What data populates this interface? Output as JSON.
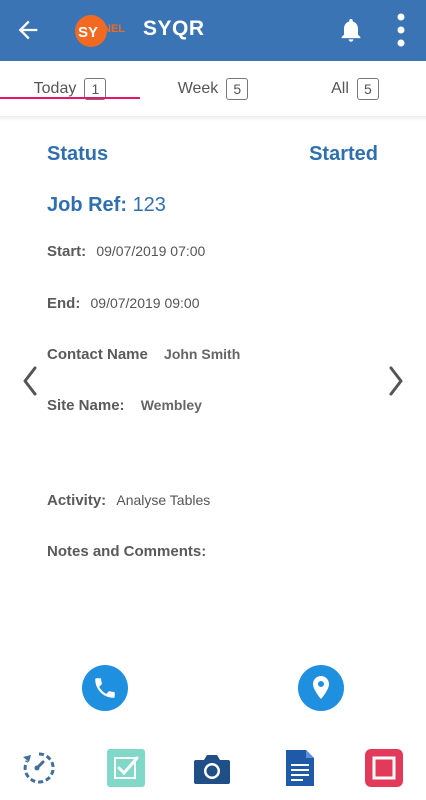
{
  "appbar": {
    "logo_alt": "SYNEL",
    "title": "SYQR"
  },
  "tabs": [
    {
      "label": "Today",
      "count": "1"
    },
    {
      "label": "Week",
      "count": "5"
    },
    {
      "label": "All",
      "count": "5"
    }
  ],
  "job": {
    "status_label": "Status",
    "status_value": "Started",
    "jobref_label": "Job Ref:",
    "jobref_value": "123",
    "start_label": "Start:",
    "start_value": "09/07/2019 07:00",
    "end_label": "End:",
    "end_value": "09/07/2019 09:00",
    "contact_label": "Contact Name",
    "contact_value": "John Smith",
    "site_label": "Site Name:",
    "site_value": "Wembley",
    "activity_label": "Activity:",
    "activity_value": "Analyse Tables",
    "notes_label": "Notes and Comments:"
  },
  "icons": {
    "back": "arrow-left-icon",
    "bell": "bell-icon",
    "more": "more-vert-icon",
    "prev": "chevron-left-icon",
    "next": "chevron-right-icon",
    "call": "phone-icon",
    "location": "map-pin-icon",
    "bottom": [
      "refresh-icon",
      "checkbox-icon",
      "camera-icon",
      "document-icon",
      "stop-icon"
    ]
  },
  "colors": {
    "appbar": "#3a74b4",
    "accent": "#2f6fae",
    "tab_indicator": "#e2176b",
    "action_blue": "#1f8fe0"
  }
}
